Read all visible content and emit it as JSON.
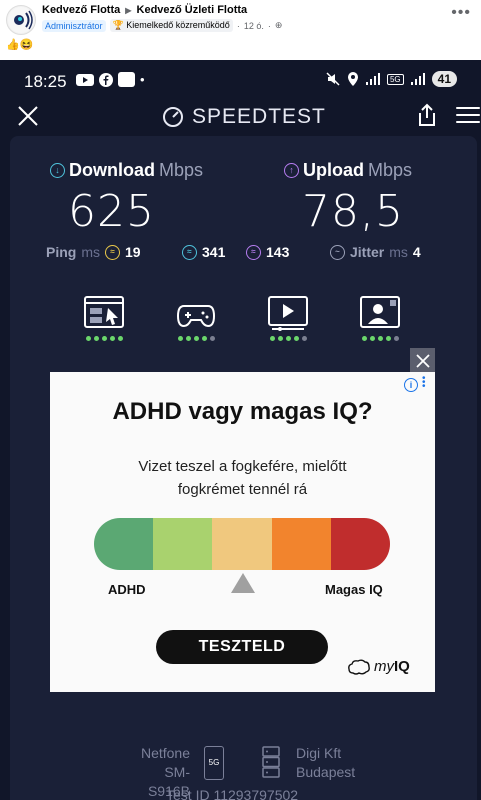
{
  "post": {
    "group_name": "Kedvező Flotta",
    "page_name": "Kedvező Üzleti Flotta",
    "role_badge": "Adminisztrátor",
    "contributor_badge": "Kiemelkedő közreműködő",
    "time": "12 ó.",
    "reactions": "👍😆"
  },
  "status_bar": {
    "time": "18:25",
    "battery": "41",
    "network": "5G"
  },
  "app": {
    "title": "SPEEDTEST"
  },
  "results": {
    "download_label": "Download",
    "download_unit": "Mbps",
    "download_value": "625",
    "upload_label": "Upload",
    "upload_unit": "Mbps",
    "upload_value": "78,5",
    "ping_label": "Ping",
    "ping_unit": "ms",
    "ping_idle": "19",
    "ping_download": "341",
    "ping_upload": "143",
    "jitter_label": "Jitter",
    "jitter_unit": "ms",
    "jitter_value": "4"
  },
  "categories": [
    {
      "name": "web-browsing",
      "icon": "browser-cursor-icon",
      "rating": 5
    },
    {
      "name": "gaming",
      "icon": "gamepad-icon",
      "rating": 4
    },
    {
      "name": "video-streaming",
      "icon": "video-player-icon",
      "rating": 4
    },
    {
      "name": "video-chat",
      "icon": "video-call-icon",
      "rating": 4
    }
  ],
  "ad": {
    "headline": "ADHD vagy magas IQ?",
    "subtext_line1": "Vizet teszel a fogkefére, mielőtt",
    "subtext_line2": "fogkrémet tennél rá",
    "left_label": "ADHD",
    "right_label": "Magas IQ",
    "button": "TESZTELD",
    "logo_text_my": "my",
    "logo_text_iq": "IQ",
    "scale_colors": [
      "#5ba873",
      "#a9d26e",
      "#f0c87e",
      "#f2842d",
      "#c02d2d"
    ]
  },
  "footer": {
    "isp": "Netfone",
    "device": "SM-S916B",
    "network_badge": "5G",
    "server": "Digi Kft",
    "server_city": "Budapest",
    "test_id_label": "Test ID 11293797502"
  },
  "colors": {
    "accent_cyan": "#4fc3dc",
    "accent_purple": "#b67df0",
    "accent_yellow": "#e9c84a",
    "background": "#111629",
    "card": "#1a2037"
  }
}
